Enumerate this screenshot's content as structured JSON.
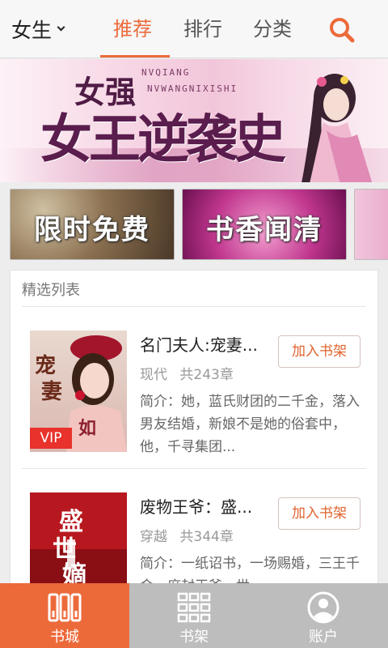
{
  "header": {
    "gender": "女生",
    "tabs": [
      {
        "label": "推荐",
        "active": true
      },
      {
        "label": "排行",
        "active": false
      },
      {
        "label": "分类",
        "active": false
      }
    ],
    "accent_color": "#ec6a3a"
  },
  "banner": {
    "title_line1": "女强",
    "title_line2": "女王逆袭史",
    "pinyin_line1": "NVQIANG",
    "pinyin_line2": "NVWANGNIXISHI"
  },
  "tiles": [
    {
      "label": "限时免费"
    },
    {
      "label": "书香闻清"
    }
  ],
  "list": {
    "title": "精选列表",
    "books": [
      {
        "title": "名门夫人:宠妻...",
        "category": "现代",
        "chapters": "共243章",
        "description": "简介：她，蓝氏财团的二千金，落入男友结婚，新娘不是她的俗套中，他，千寻集团...",
        "add_label": "加入书架",
        "badge": "VIP"
      },
      {
        "title": "废物王爷：盛...",
        "category": "穿越",
        "chapters": "共344章",
        "description": "简介：一纸诏书，一场赐婚，三王千金，庶封王爷，世",
        "add_label": "加入书架"
      }
    ]
  },
  "bottom_nav": [
    {
      "label": "书城",
      "active": true
    },
    {
      "label": "书架",
      "active": false
    },
    {
      "label": "账户",
      "active": false
    }
  ]
}
